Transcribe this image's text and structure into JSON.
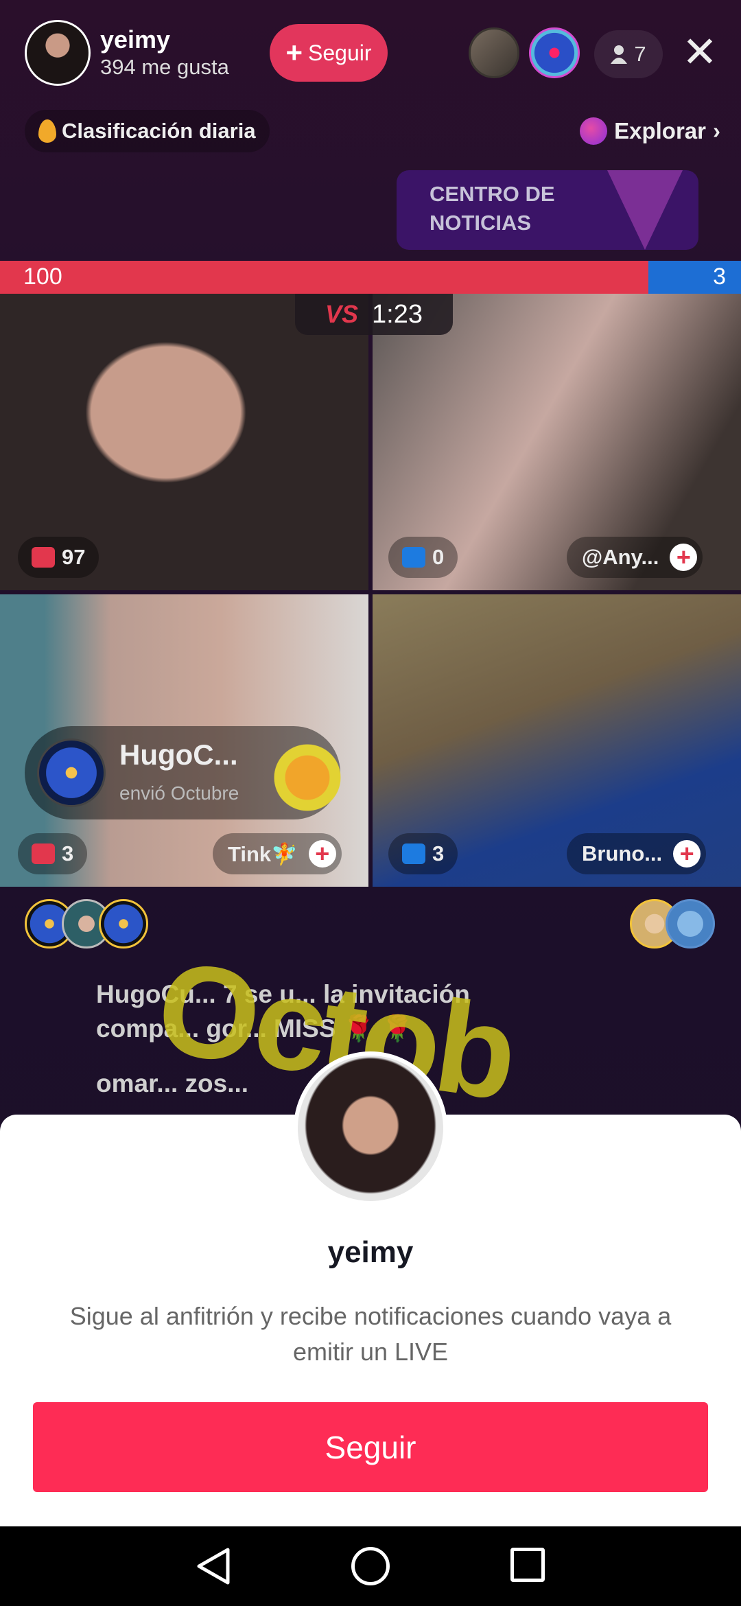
{
  "host": {
    "name": "yeimy",
    "likes": "394 me gusta",
    "follow_label": "Seguir",
    "viewer_count": "7"
  },
  "ranking": {
    "label": "Clasificación diaria"
  },
  "explore": {
    "label": "Explorar",
    "chevron": "›"
  },
  "news": {
    "label": "CENTRO DE NOTICIAS"
  },
  "battle": {
    "left_score": "100",
    "right_score": "3",
    "vs": "VS",
    "timer": "1:23",
    "left_share": 0.875
  },
  "tiles": [
    {
      "gifts": "97",
      "name": ""
    },
    {
      "gifts": "0",
      "name": "@Any..."
    },
    {
      "gifts": "3",
      "name": "Tink🧚"
    },
    {
      "gifts": "3",
      "name": "Bruno..."
    }
  ],
  "gift_banner": {
    "sender": "HugoC...",
    "message": "envió Octubre"
  },
  "chat": [
    "HugoCu... 7 se u... la invitación",
    "compa... gor... MISS 🌹 🌹",
    "omar... zos..."
  ],
  "sheet": {
    "name": "yeimy",
    "description": "Sigue al anfitrión y recibe notificaciones cuando vaya a emitir un LIVE",
    "button_label": "Seguir"
  },
  "colors": {
    "accent": "#fe2c55",
    "battle_red": "#e2374d",
    "battle_blue": "#1d6ed4"
  },
  "icons": [
    "close-icon",
    "person-icon",
    "flame-icon",
    "planet-icon",
    "gift-icon",
    "plus-icon",
    "back-icon",
    "home-icon",
    "recent-apps-icon"
  ]
}
